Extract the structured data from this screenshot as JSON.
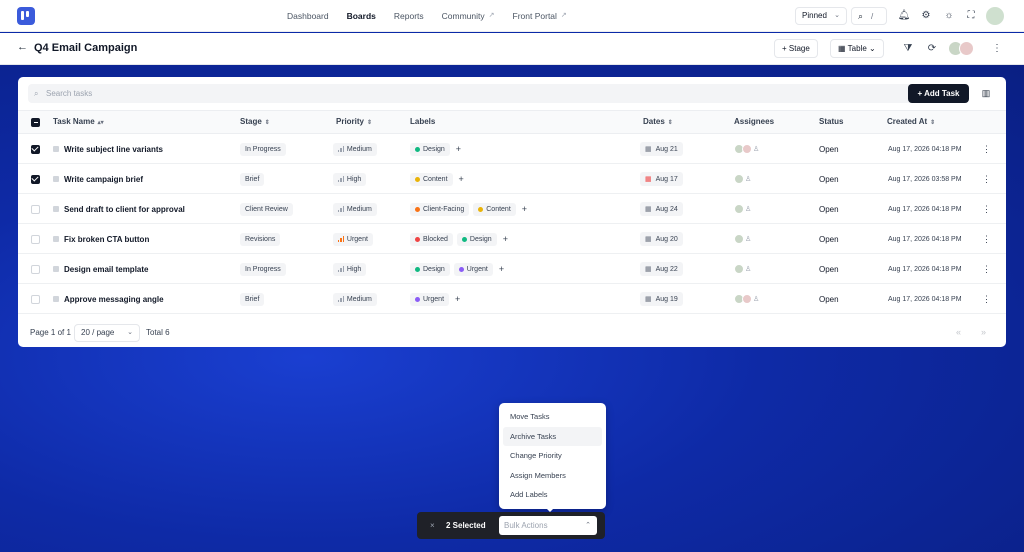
{
  "nav": {
    "links": [
      {
        "label": "Dashboard",
        "active": false,
        "ext": ""
      },
      {
        "label": "Boards",
        "active": true,
        "ext": ""
      },
      {
        "label": "Reports",
        "active": false,
        "ext": ""
      },
      {
        "label": "Community",
        "active": false,
        "ext": "↗"
      },
      {
        "label": "Front Portal",
        "active": false,
        "ext": "↗"
      }
    ],
    "pinned_label": "Pinned",
    "search_shortcut": "/"
  },
  "header": {
    "back": "←",
    "title": "Q4 Email Campaign",
    "stage_button": "Stage",
    "view_button": "Table"
  },
  "table": {
    "search_placeholder": "Search tasks",
    "add_task_label": "Add Task",
    "columns": {
      "name": "Task Name",
      "stage": "Stage",
      "priority": "Priority",
      "labels": "Labels",
      "dates": "Dates",
      "assignees": "Assignees",
      "status": "Status",
      "created": "Created At"
    },
    "rows": [
      {
        "checked": true,
        "name": "Write subject line variants",
        "stage": "In Progress",
        "priority": "Medium",
        "labels": [
          {
            "text": "Design",
            "color": "#10b981"
          }
        ],
        "date": "Aug 21",
        "overdue": false,
        "assignees": 2,
        "status": "Open",
        "created": "Aug 17, 2026 04:18 PM"
      },
      {
        "checked": true,
        "name": "Write campaign brief",
        "stage": "Brief",
        "priority": "High",
        "labels": [
          {
            "text": "Content",
            "color": "#eab308"
          }
        ],
        "date": "Aug 17",
        "overdue": true,
        "assignees": 1,
        "status": "Open",
        "created": "Aug 17, 2026 03:58 PM"
      },
      {
        "checked": false,
        "name": "Send draft to client for approval",
        "stage": "Client Review",
        "priority": "Medium",
        "labels": [
          {
            "text": "Client-Facing",
            "color": "#f97316"
          },
          {
            "text": "Content",
            "color": "#eab308"
          }
        ],
        "date": "Aug 24",
        "overdue": false,
        "assignees": 1,
        "status": "Open",
        "created": "Aug 17, 2026 04:18 PM"
      },
      {
        "checked": false,
        "name": "Fix broken CTA button",
        "stage": "Revisions",
        "priority": "Urgent",
        "labels": [
          {
            "text": "Blocked",
            "color": "#ef4444"
          },
          {
            "text": "Design",
            "color": "#10b981"
          }
        ],
        "date": "Aug 20",
        "overdue": false,
        "assignees": 1,
        "status": "Open",
        "created": "Aug 17, 2026 04:18 PM"
      },
      {
        "checked": false,
        "name": "Design email template",
        "stage": "In Progress",
        "priority": "High",
        "labels": [
          {
            "text": "Design",
            "color": "#10b981"
          },
          {
            "text": "Urgent",
            "color": "#8b5cf6"
          }
        ],
        "date": "Aug 22",
        "overdue": false,
        "assignees": 1,
        "status": "Open",
        "created": "Aug 17, 2026 04:18 PM"
      },
      {
        "checked": false,
        "name": "Approve messaging angle",
        "stage": "Brief",
        "priority": "Medium",
        "labels": [
          {
            "text": "Urgent",
            "color": "#8b5cf6"
          }
        ],
        "date": "Aug 19",
        "overdue": false,
        "assignees": 2,
        "status": "Open",
        "created": "Aug 17, 2026 04:18 PM"
      }
    ],
    "footer": {
      "page": "Page 1 of 1",
      "per_page": "20 / page",
      "total": "Total 6",
      "prev": "«",
      "next": "»"
    }
  },
  "bulk": {
    "selected": "2 Selected",
    "placeholder": "Bulk Actions",
    "close": "×",
    "menu": [
      "Move Tasks",
      "Archive Tasks",
      "Change Priority",
      "Assign Members",
      "Add Labels"
    ],
    "hover_index": 1
  },
  "colors": {
    "accent": "#3b5bdb",
    "background": "#0b2aa8",
    "urgent": "#f97316",
    "overdue": "#ef4444"
  }
}
